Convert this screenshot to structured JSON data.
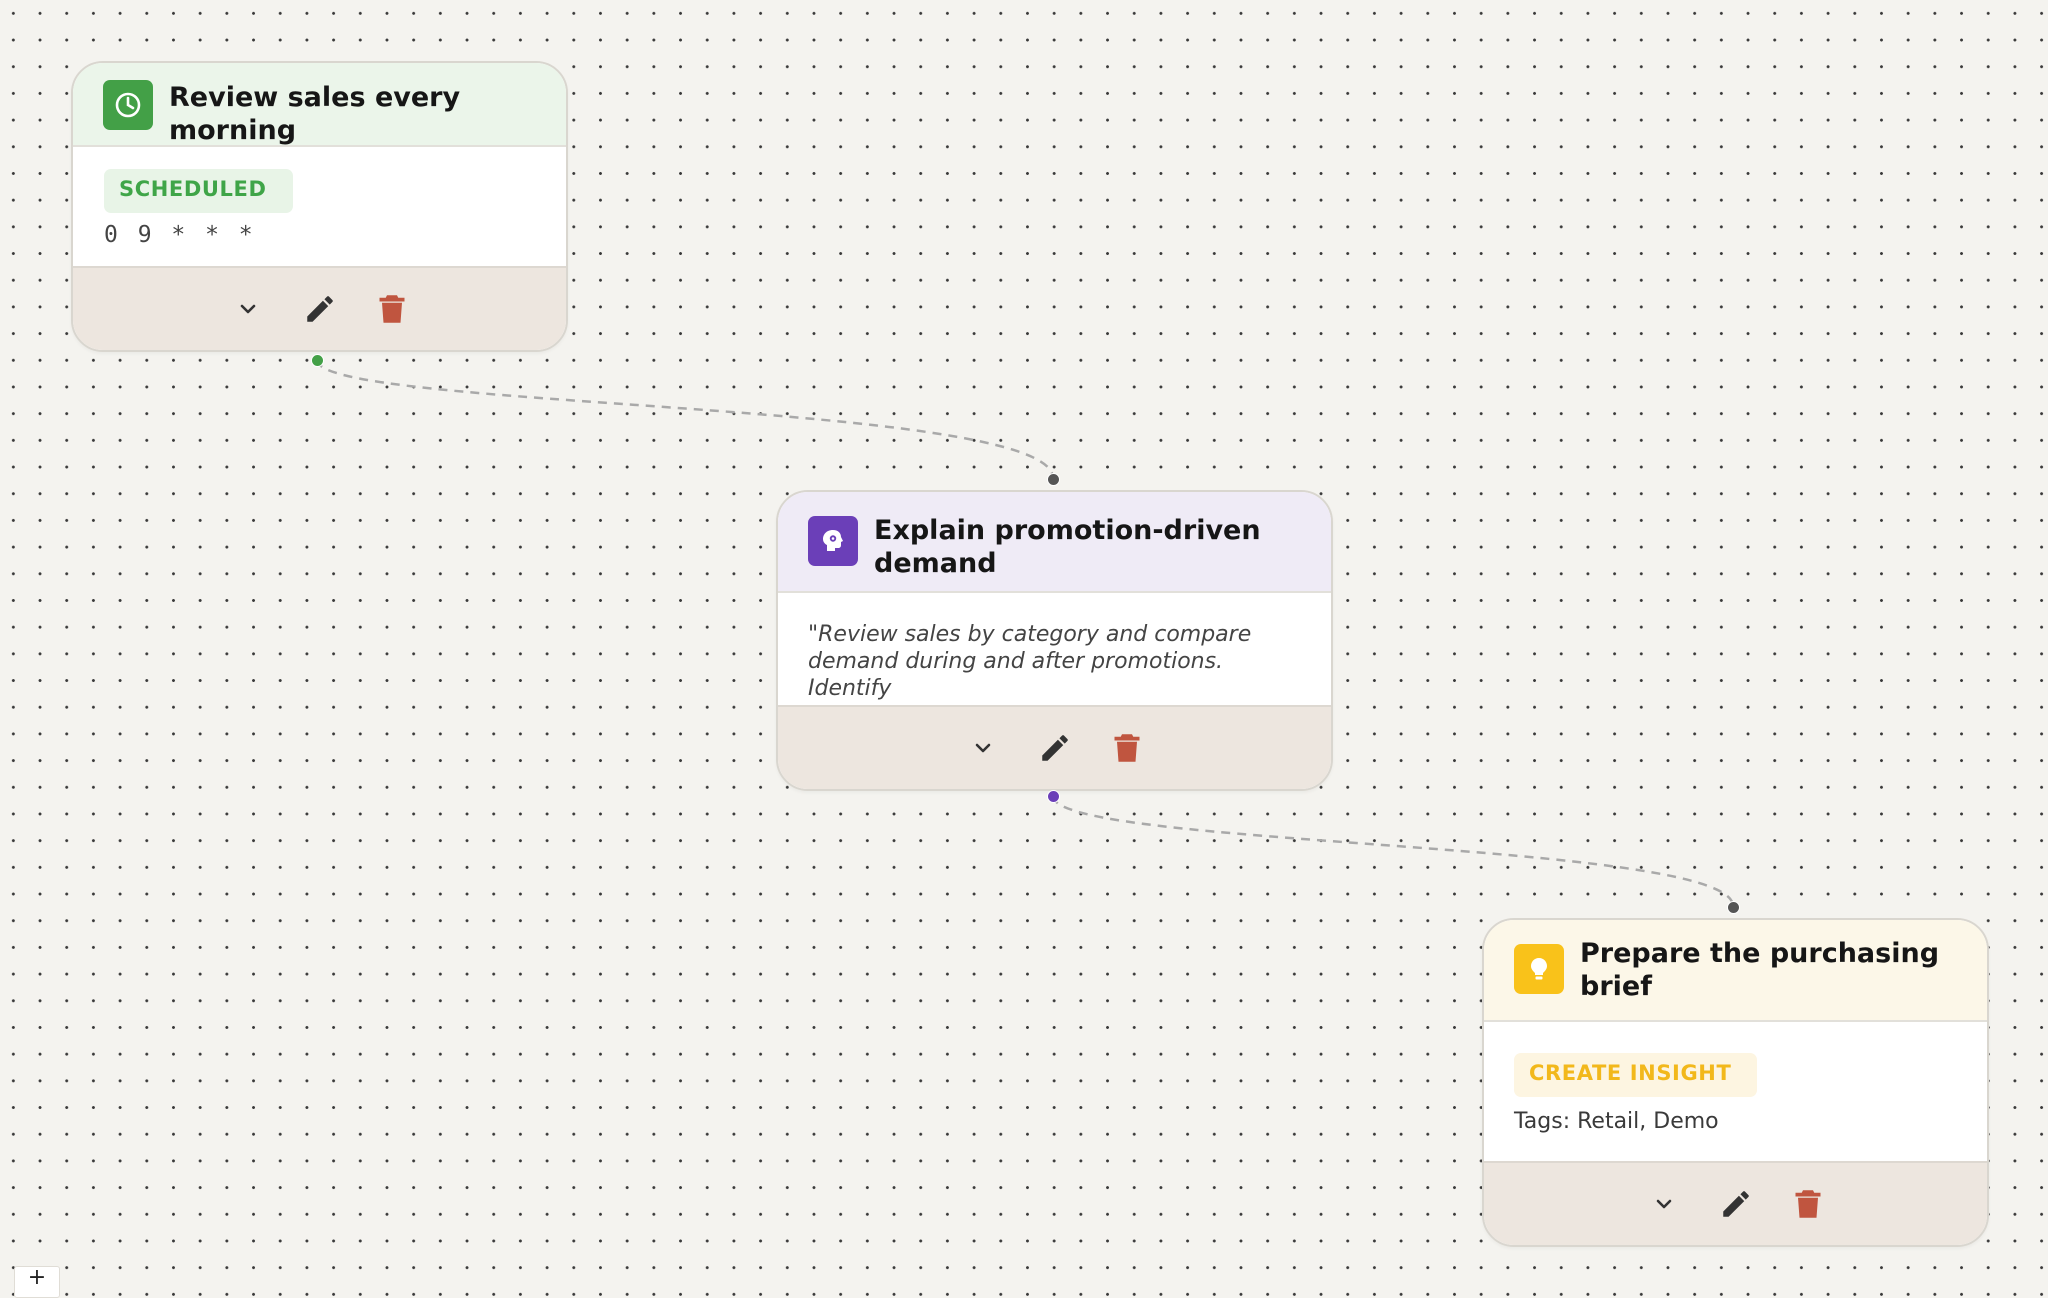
{
  "nodes": [
    {
      "title": "Review sales every morning",
      "icon": "clock-icon",
      "accent": "#43a047",
      "header_bg": "#ebf5ea",
      "pill": "SCHEDULED",
      "pill_color": "#3fa548",
      "pill_bg": "#e8f4e7",
      "detail": "0 9 * * *"
    },
    {
      "title": "Explain promotion-driven demand",
      "icon": "brain-gear-icon",
      "accent": "#6b3fb8",
      "header_bg": "#efebf6",
      "quote": "\"Review sales by category and compare demand during and after promotions. Identify"
    },
    {
      "title": "Prepare the purchasing brief",
      "icon": "lightbulb-icon",
      "accent": "#f9c21a",
      "header_bg": "#fcf7e8",
      "pill": "CREATE INSIGHT",
      "pill_color": "#f2b81b",
      "pill_bg": "#fdf5e1",
      "tags": "Tags: Retail, Demo"
    }
  ],
  "footer_actions": [
    "expand",
    "edit",
    "delete"
  ],
  "colors": {
    "edge": "#a9a9a9",
    "delete": "#c0553f",
    "edit": "#333333",
    "footer_bg": "#ede6df"
  },
  "corner_control": "+"
}
